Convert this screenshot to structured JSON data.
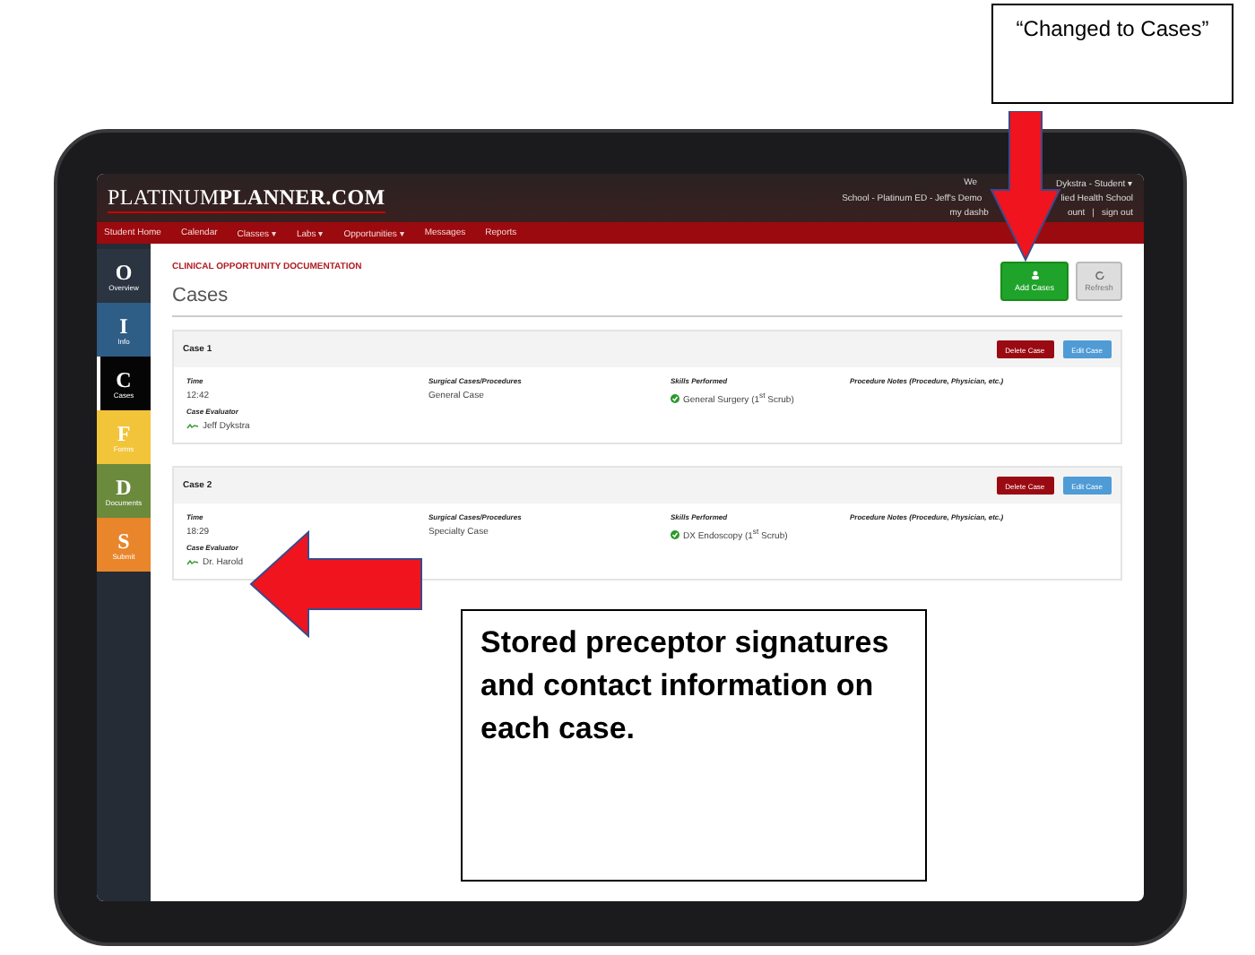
{
  "annotation": {
    "text": "“Changed to Cases”"
  },
  "callout": {
    "text": "Stored preceptor signatures and contact information on each case."
  },
  "logo": {
    "part_1": "PLATINUM",
    "part_2": "PLANNER.COM"
  },
  "user_info": {
    "lines": [
      [
        "We",
        "Dykstra - Student ▾"
      ],
      [
        "School - Platinum ED - Jeff's Demo",
        "lied Health School"
      ],
      [
        "my dashb",
        "ount",
        "|",
        "sign out"
      ]
    ]
  },
  "nav": [
    {
      "label": "Student Home"
    },
    {
      "label": "Calendar"
    },
    {
      "label": "Classes ▾"
    },
    {
      "label": "Labs ▾"
    },
    {
      "label": "Opportunities ▾"
    },
    {
      "label": "Messages"
    },
    {
      "label": "Reports"
    }
  ],
  "sidebar": [
    {
      "letter": "O",
      "label": "Overview",
      "color": "#2b3441",
      "selected": false
    },
    {
      "letter": "I",
      "label": "Info",
      "color": "#2e5d86",
      "selected": false
    },
    {
      "letter": "C",
      "label": "Cases",
      "color": "#050505",
      "selected": true
    },
    {
      "letter": "F",
      "label": "Forms",
      "color": "#f2c43a",
      "selected": false
    },
    {
      "letter": "D",
      "label": "Documents",
      "color": "#6b8a3c",
      "selected": false
    },
    {
      "letter": "S",
      "label": "Submit",
      "color": "#e9852a",
      "selected": false
    }
  ],
  "section_title": "CLINICAL OPPORTUNITY DOCUMENTATION",
  "page_title": "Cases",
  "actions": [
    {
      "kind": "add",
      "label": "Add Cases"
    },
    {
      "kind": "refresh",
      "label": "Refresh"
    }
  ],
  "cases": [
    {
      "title": "Case 1",
      "buttons": [
        {
          "kind": "delete",
          "label": "Delete Case"
        },
        {
          "kind": "edit",
          "label": "Edit Case"
        }
      ],
      "time_label": "Time",
      "time": "12:42",
      "evaluator_label": "Case Evaluator",
      "evaluator": "Jeff Dykstra",
      "procedures_label": "Surgical Cases/Procedures",
      "procedure": "General Case",
      "skills_label": "Skills Performed",
      "skill": "General Surgery (1$^{st}$ Scrub)",
      "notes_label": "Procedure Notes (Procedure, Physician, etc.)"
    },
    {
      "title": "Case 2",
      "buttons": [
        {
          "kind": "delete",
          "label": "Delete Case"
        },
        {
          "kind": "edit",
          "label": "Edit Case"
        }
      ],
      "time_label": "Time",
      "time": "18:29",
      "evaluator_label": "Case Evaluator",
      "evaluator": "Dr. Harold",
      "procedures_label": "Surgical Cases/Procedures",
      "procedure": "Specialty Case",
      "skills_label": "Skills Performed",
      "skill": "DX Endoscopy (1$^{st}$ Scrub)",
      "notes_label": "Procedure Notes (Procedure, Physician, etc.)"
    }
  ]
}
